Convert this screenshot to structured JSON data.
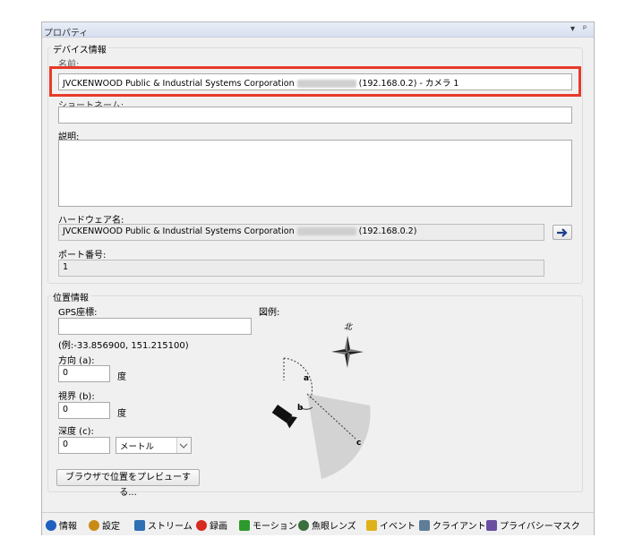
{
  "panel": {
    "title": "プロパティ",
    "menu_icon": "dropdown-arrow-icon",
    "pin_icon": "pin-icon"
  },
  "device_info": {
    "group_label": "デバイス情報",
    "name_label": "名前:",
    "name_value_prefix": "JVCKENWOOD Public & Industrial Systems Corporation",
    "name_value_suffix": "(192.168.0.2) - カメラ 1",
    "shortname_label": "ショートネーム:",
    "shortname_value": "",
    "description_label": "説明:",
    "description_value": "",
    "hardware_label": "ハードウェア名:",
    "hardware_value_prefix": "JVCKENWOOD Public & Industrial Systems Corporation",
    "hardware_value_suffix": "(192.168.0.2)",
    "port_label": "ポート番号:",
    "port_value": "1"
  },
  "position_info": {
    "group_label": "位置情報",
    "gps_label": "GPS座標:",
    "gps_value": "",
    "gps_example": "(例:-33.856900, 151.215100)",
    "direction_label": "方向 (a):",
    "direction_value": "0",
    "direction_unit": "度",
    "fov_label": "視界 (b):",
    "fov_value": "0",
    "fov_unit": "度",
    "depth_label": "深度 (c):",
    "depth_value": "0",
    "depth_unit_selected": "メートル",
    "preview_button": "ブラウザで位置をプレビューする...",
    "legend_label": "図例:",
    "legend_north": "北",
    "legend_a": "a",
    "legend_b": "b",
    "legend_c": "c"
  },
  "tabs": [
    {
      "label": "情報",
      "icon": "info-icon",
      "color": "#1f5fbf"
    },
    {
      "label": "設定",
      "icon": "settings-gear-icon",
      "color": "#c98b16"
    },
    {
      "label": "ストリーム",
      "icon": "stream-icon",
      "color": "#2f6fb5"
    },
    {
      "label": "録画",
      "icon": "record-icon",
      "color": "#d62b1f"
    },
    {
      "label": "モーション",
      "icon": "motion-runner-icon",
      "color": "#2c9a2c"
    },
    {
      "label": "魚眼レンズ",
      "icon": "fisheye-lens-icon",
      "color": "#3a6e3a"
    },
    {
      "label": "イベント",
      "icon": "event-lightning-icon",
      "color": "#e0b21a"
    },
    {
      "label": "クライアント",
      "icon": "client-monitor-icon",
      "color": "#5f7d99"
    },
    {
      "label": "プライバシーマスク",
      "icon": "privacy-mask-icon",
      "color": "#6a4fa0"
    }
  ],
  "colors": {
    "highlight": "#e8392a",
    "panel_bg": "#f0f0f0"
  }
}
